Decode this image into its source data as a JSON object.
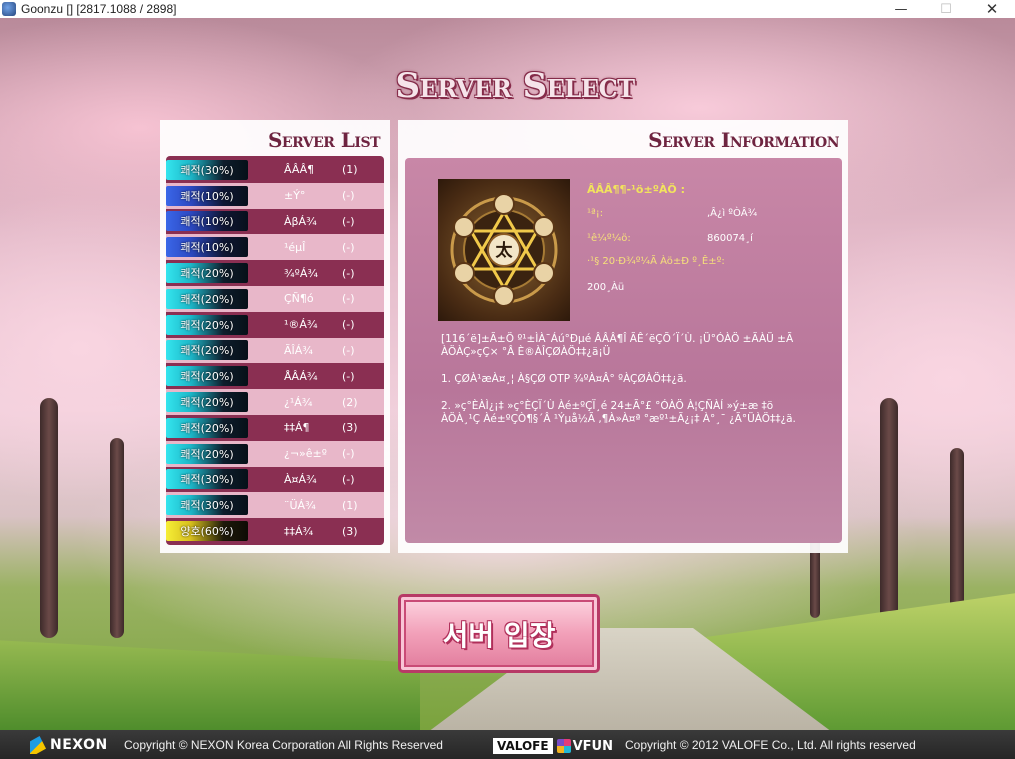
{
  "window": {
    "title": "Goonzu [] [2817.1088 / 2898]",
    "minimize_glyph": "—",
    "maximize_glyph": "☐",
    "close_glyph": "✕"
  },
  "page_title": "Server Select",
  "server_list": {
    "heading": "Server List",
    "servers": [
      {
        "status": "쾌적(30%)",
        "status_color": "cyan",
        "name": "ÂÂÂ¶",
        "count": "(1)"
      },
      {
        "status": "쾌적(10%)",
        "status_color": "blue",
        "name": "±Ý°­",
        "count": "(-)"
      },
      {
        "status": "쾌적(10%)",
        "status_color": "blue",
        "name": "ÀβÁ¾",
        "count": "(-)"
      },
      {
        "status": "쾌적(10%)",
        "status_color": "blue",
        "name": "¹éµÎ",
        "count": "(-)"
      },
      {
        "status": "쾌적(20%)",
        "status_color": "cyan",
        "name": "¾ºÁ¾",
        "count": "(-)"
      },
      {
        "status": "쾌적(20%)",
        "status_color": "cyan",
        "name": "ÇÑ¶ó",
        "count": "(-)"
      },
      {
        "status": "쾌적(20%)",
        "status_color": "cyan",
        "name": "¹®Á¾",
        "count": "(-)"
      },
      {
        "status": "쾌적(20%)",
        "status_color": "cyan",
        "name": "ÃÎÁ¾",
        "count": "(-)"
      },
      {
        "status": "쾌적(20%)",
        "status_color": "cyan",
        "name": "ÅÂÁ¾",
        "count": "(-)"
      },
      {
        "status": "쾌적(20%)",
        "status_color": "cyan",
        "name": "¿¹Á¾",
        "count": "(2)"
      },
      {
        "status": "쾌적(20%)",
        "status_color": "cyan",
        "name": "‡‡Á¶",
        "count": "(3)"
      },
      {
        "status": "쾌적(20%)",
        "status_color": "cyan",
        "name": "¿¬»ê±º",
        "count": "(-)"
      },
      {
        "status": "쾌적(30%)",
        "status_color": "cyan",
        "name": "À¤Á¾",
        "count": "(-)"
      },
      {
        "status": "쾌적(30%)",
        "status_color": "cyan",
        "name": "¨ÜÁ¾",
        "count": "(1)"
      },
      {
        "status": "양호(60%)",
        "status_color": "yellow",
        "name": "‡‡Á¾",
        "count": "(3)"
      }
    ]
  },
  "server_info": {
    "heading": "Server Information",
    "emblem_icon": "taiji-emblem",
    "info_title": "ÂÂÂ¶¶-¹ö±ºÀÖ :",
    "rows": [
      {
        "label": "¹ª¡:",
        "value": ",Â¿ì ºÒÂ¾"
      },
      {
        "label": "¹ê¼º¼ö:",
        "value": "860074¸í"
      },
      {
        "label": "·¹§ 20·Ð¾º¼Ã Àö±Ð º¸Ê±º:",
        "value": ""
      },
      {
        "label": "200¸Àü",
        "value": ""
      }
    ],
    "notice": [
      "[116´ë]±Ã±Ö º¹±ÌÀ¯Áú°Ðµé ÂÂÂ¶Î ÃÊ´ëÇÕ´Ï´Ù. ¡Ü°ÓÀÖ ±ÃÀÜ ±Ã ÀÖÀÇ»çÇ× °Â È®ÀÎÇØÀÖ‡‡¿ä¡Ü",
      "1. ÇØÀ¹æÀ¤¸¦ À§ÇØ OTP ¾ºÀ¤Â° ºÀÇØÀÖ‡‡¿ä.",
      "2. »ç°ÈÀÌ¿¡‡­ »ç°ÈÇÏ´Ù Àé±ºÇÏ¸é 24±Ã°£ °ÓÀÖ À¦ÇÑÀÍ »ý±æ ‡ö ÀÖÀ¸¹Ç Àé±ºÇÒ¶§´Â ¹Ýµå½Ã ,¶À»À¤ª °æº¹±Ã¿¡‡­ À°¸¯ ¿Ã°ÜÀÖ‡‡¿ä."
    ]
  },
  "enter_button_label": "서버 입장",
  "footer": {
    "nexon_logo_text": "NEXON",
    "nexon_copyright": "Copyright © NEXON Korea Corporation All Rights Reserved",
    "valofe_logo_text": "VALOFE",
    "vfun_logo_text": "VFUN",
    "valofe_copyright": "Copyright © 2012 VALOFE Co., Ltd. All rights reserved"
  },
  "colors": {
    "accent": "#8a2f52",
    "heading": "#6e2440",
    "gold": "#f2e35d"
  }
}
